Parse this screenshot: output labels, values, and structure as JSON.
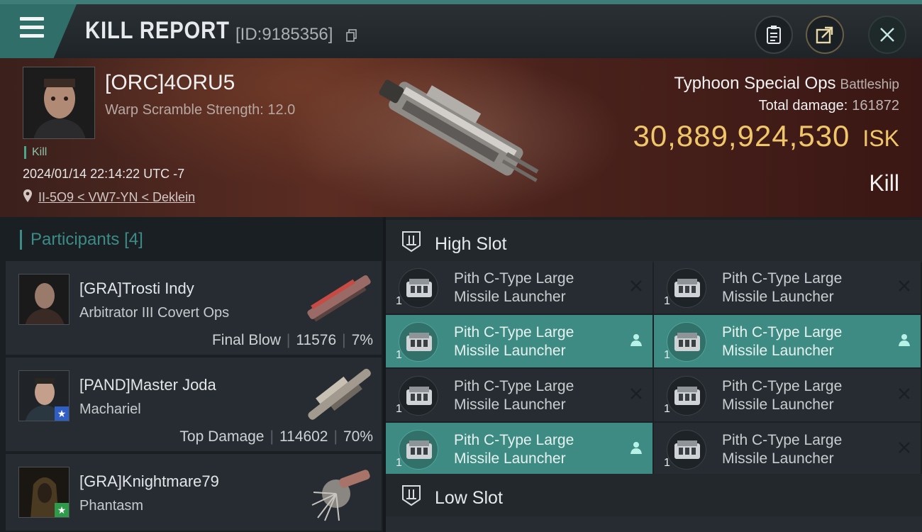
{
  "header": {
    "title": "KILL REPORT",
    "report_id": "[ID:9185356]",
    "buttons": [
      {
        "name": "clipboard",
        "icon": "clipboard-icon"
      },
      {
        "name": "share",
        "icon": "share-icon"
      },
      {
        "name": "close",
        "icon": "close-icon"
      }
    ],
    "accent": "#3e7d78"
  },
  "victim": {
    "name": "[ORC]4ORU5",
    "warp_scramble": "Warp Scramble Strength: 12.0",
    "kill_tag": "Kill",
    "datetime": "2024/01/14 22:14:22 UTC -7",
    "location": "II-5O9 < VW7-YN < Deklein",
    "ship_name": "Typhoon Special Ops",
    "ship_class": "Battleship",
    "total_damage_label": "Total damage:",
    "total_damage": "161872",
    "isk_value": "30,889,924,530",
    "isk_unit": "ISK",
    "result": "Kill",
    "isk_color": "#f0c66a"
  },
  "participants": {
    "label": "Participants",
    "count": "[4]",
    "rows": [
      {
        "name": "[GRA]Trosti Indy",
        "ship": "Arbitrator III Covert Ops",
        "role": "Final Blow",
        "damage": "11576",
        "percent": "7%",
        "badge": ""
      },
      {
        "name": "[PAND]Master Joda",
        "ship": "Machariel",
        "role": "Top Damage",
        "damage": "114602",
        "percent": "70%",
        "badge": "blue-star"
      },
      {
        "name": "[GRA]Knightmare79",
        "ship": "Phantasm",
        "role": "",
        "damage": "",
        "percent": "",
        "badge": "green-star"
      }
    ]
  },
  "slots": {
    "high": {
      "label": "High Slot",
      "items": [
        {
          "name_line1": "Pith C-Type Large",
          "name_line2": "Missile Launcher",
          "qty": "1",
          "status": "destroyed"
        },
        {
          "name_line1": "Pith C-Type Large",
          "name_line2": "Missile Launcher",
          "qty": "1",
          "status": "destroyed"
        },
        {
          "name_line1": "Pith C-Type Large",
          "name_line2": "Missile Launcher",
          "qty": "1",
          "status": "dropped"
        },
        {
          "name_line1": "Pith C-Type Large",
          "name_line2": "Missile Launcher",
          "qty": "1",
          "status": "dropped"
        },
        {
          "name_line1": "Pith C-Type Large",
          "name_line2": "Missile Launcher",
          "qty": "1",
          "status": "destroyed"
        },
        {
          "name_line1": "Pith C-Type Large",
          "name_line2": "Missile Launcher",
          "qty": "1",
          "status": "destroyed"
        },
        {
          "name_line1": "Pith C-Type Large",
          "name_line2": "Missile Launcher",
          "qty": "1",
          "status": "dropped"
        },
        {
          "name_line1": "Pith C-Type Large",
          "name_line2": "Missile Launcher",
          "qty": "1",
          "status": "destroyed"
        }
      ]
    },
    "low": {
      "label": "Low Slot"
    },
    "highlight_color": "#3e8b84"
  }
}
